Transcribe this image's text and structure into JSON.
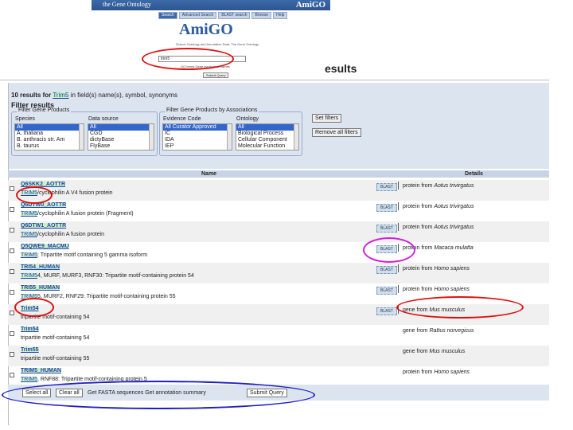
{
  "amigo": {
    "header_title": "the Gene Ontology",
    "header_logo": "AmiGO",
    "nav": [
      "Search",
      "Advanced Search",
      "BLAST search",
      "Browse",
      "Help"
    ],
    "logo": "AmiGO",
    "intro": "Search Ontology and Annotation Data: The Gene Ontology",
    "search_value": "trim5",
    "radio_label": "GO terms  Gene symbols or names",
    "submit": "Submit Query"
  },
  "results_word": "esults",
  "count": {
    "prefix": "10 results for",
    "term": "Trim5",
    "suffix": "in field(s) name(s), symbol, synonyms"
  },
  "filter_header": "Filter results",
  "fs1": {
    "legend": "Filter Gene Products",
    "species_label": "Species",
    "species": [
      "All",
      "A. thaliana",
      "B. anthracis str. Am",
      "B. taurus"
    ],
    "source_label": "Data source",
    "source": [
      "All",
      "CGD",
      "dictyBase",
      "FlyBase"
    ]
  },
  "fs2": {
    "legend": "Filter Gene Products by Associations",
    "evidence_label": "Evidence Code",
    "evidence": [
      "All Curator Approved",
      "IC",
      "IDA",
      "IEP"
    ],
    "ontology_label": "Ontology",
    "ontology": [
      "All",
      "Biological Process",
      "Cellular Component",
      "Molecular Function"
    ]
  },
  "set_filters": "Set filters",
  "remove_filters": "Remove all filters",
  "table": {
    "col_name": "Name",
    "col_details": "Details",
    "rows": [
      {
        "name": "Q6SKK2_AOTTR",
        "sym": "TRIM5",
        "rest": "/cyclophilin A V4 fusion protein",
        "blast": "BLAST",
        "det_pre": "protein from",
        "det_sp": "Aotus trivirgatus"
      },
      {
        "name": "Q6DTW0_AOTTR",
        "sym": "TRIM5",
        "rest": "/cyclophilin A fusion protein (Fragment)",
        "blast": "BLAST",
        "det_pre": "protein from",
        "det_sp": "Aotus trivirgatus"
      },
      {
        "name": "Q6DTW1_AOTTR",
        "sym": "TRIM5",
        "rest": "/cyclophilin A fusion protein",
        "blast": "BLAST",
        "det_pre": "protein from",
        "det_sp": "Aotus trivirgatus"
      },
      {
        "name": "Q5QWE9_MACMU",
        "sym": "TRIM5",
        "rest": "; Tripartite motif containing 5 gamma isoform",
        "blast": "BLAST",
        "det_pre": "protein from",
        "det_sp": "Macaca mulatta"
      },
      {
        "name": "TRI54_HUMAN",
        "sym": "TRIM5",
        "rest": "4, MURF, MURF3, RNF30: Tripartite motif-containing protein 54",
        "blast": "BLAST",
        "det_pre": "protein from",
        "det_sp": "Homo sapiens"
      },
      {
        "name": "TRI55_HUMAN",
        "sym": "TRIM5",
        "rest": "5, MURF2, RNF29: Tripartite motif-containing protein 55",
        "blast": "BLAST",
        "det_pre": "protein from",
        "det_sp": "Homo sapiens"
      },
      {
        "name": "Trim54",
        "sym": "",
        "rest": "tripartite motif-containing 54",
        "blast": "BLAST",
        "det_pre": "gene from",
        "det_sp": "Mus musculus"
      },
      {
        "name": "Trim54",
        "sym": "",
        "rest": "tripartite motif-containing 54",
        "blast": "",
        "det_pre": "gene from",
        "det_sp": "Rattus norvegicus"
      },
      {
        "name": "Trim55",
        "sym": "",
        "rest": "tripartite motif-containing 55",
        "blast": "",
        "det_pre": "gene from",
        "det_sp": "Mus musculus"
      },
      {
        "name": "TRIM5_HUMAN",
        "sym": "TRIM5",
        "rest": ", RNF88: Tripartite motif-containing protein 5",
        "blast": "",
        "det_pre": "protein from",
        "det_sp": "Homo sapiens"
      }
    ]
  },
  "bottom": {
    "select_all": "Select all",
    "clear_all": "Clear all",
    "opts": "Get FASTA sequences  Get annotation summary",
    "submit": "Submit Query"
  },
  "colors": {
    "red": "#e01010",
    "magenta": "#d020e0",
    "blue": "#2020c0",
    "panel": "#dce4f0"
  }
}
